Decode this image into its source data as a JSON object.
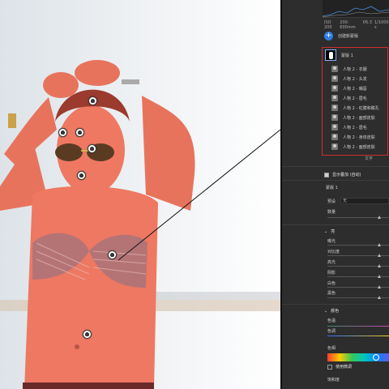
{
  "histogram": {
    "iso": "ISO 200",
    "focal": "200-600mm",
    "aperture": "f/6.3",
    "shutter": "1/1000 s"
  },
  "mask_panel": {
    "new_mask_label": "创建新蒙版",
    "mask_name": "蒙版 1",
    "sub_masks": [
      "人物 2 - 衣服",
      "人物 2 - 头发",
      "人物 2 - 嘴唇",
      "人物 2 - 眉毛",
      "人物 2 - 虹膜和瞳孔",
      "人物 2 - 面部皮肤",
      "人物 2 - 眉毛",
      "人物 2 - 身体皮肤",
      "人物 2 - 面部皮肤"
    ],
    "text_tool": "文字"
  },
  "overlay": {
    "show_overlay_label": "显示叠加 (自动)",
    "mask_label": "蒙版 1",
    "preset_label": "预设",
    "preset_value": "无",
    "amount_label": "数量"
  },
  "light_section": {
    "title": "亮",
    "rows": [
      "曝光",
      "对比度",
      "高光",
      "阴影",
      "白色",
      "黑色"
    ],
    "knob_positions": [
      0.85,
      0.85,
      0.85,
      0.85,
      0.85,
      0.85
    ]
  },
  "color_section": {
    "title": "颜色",
    "temp_label": "色温",
    "tint_label": "色调",
    "hue_label": "色相",
    "use_fine_label": "使用微调",
    "saturation_label": "饱和度"
  },
  "colors": {
    "mask_border": "#d12d2d",
    "accent": "#2f7de1",
    "skin_overlay": "#f0705a"
  }
}
